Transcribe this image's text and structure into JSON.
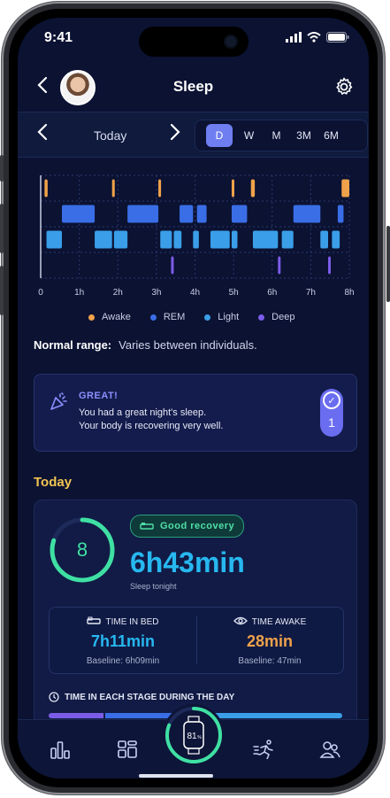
{
  "status": {
    "time": "9:41"
  },
  "header": {
    "title": "Sleep"
  },
  "date_nav": {
    "label": "Today",
    "periods": [
      "D",
      "W",
      "M",
      "3M",
      "6M"
    ],
    "selected": "D"
  },
  "chart_data": {
    "type": "timeline",
    "x_ticks": [
      "0",
      "1h",
      "2h",
      "3h",
      "4h",
      "5h",
      "6h",
      "7h",
      "8h"
    ],
    "xlim": [
      0,
      8
    ],
    "rows": [
      "Awake",
      "REM",
      "Light",
      "Deep"
    ],
    "legend": [
      {
        "label": "Awake",
        "color": "#f0a24a"
      },
      {
        "label": "REM",
        "color": "#3a6ee6"
      },
      {
        "label": "Light",
        "color": "#3a9ee8"
      },
      {
        "label": "Deep",
        "color": "#7b5ce8"
      }
    ],
    "segments": [
      {
        "stage": "Awake",
        "start": 0.1,
        "end": 0.18
      },
      {
        "stage": "Awake",
        "start": 1.85,
        "end": 1.92
      },
      {
        "stage": "Awake",
        "start": 3.05,
        "end": 3.12
      },
      {
        "stage": "Awake",
        "start": 4.95,
        "end": 5.02
      },
      {
        "stage": "Awake",
        "start": 5.45,
        "end": 5.55
      },
      {
        "stage": "Awake",
        "start": 7.8,
        "end": 8.0
      },
      {
        "stage": "REM",
        "start": 0.55,
        "end": 1.4
      },
      {
        "stage": "REM",
        "start": 2.25,
        "end": 3.05
      },
      {
        "stage": "REM",
        "start": 3.6,
        "end": 3.95
      },
      {
        "stage": "REM",
        "start": 4.05,
        "end": 4.3
      },
      {
        "stage": "REM",
        "start": 4.95,
        "end": 5.35
      },
      {
        "stage": "REM",
        "start": 6.55,
        "end": 7.25
      },
      {
        "stage": "REM",
        "start": 7.7,
        "end": 7.85
      },
      {
        "stage": "Light",
        "start": 0.15,
        "end": 0.55
      },
      {
        "stage": "Light",
        "start": 1.4,
        "end": 1.85
      },
      {
        "stage": "Light",
        "start": 1.9,
        "end": 2.25
      },
      {
        "stage": "Light",
        "start": 3.1,
        "end": 3.4
      },
      {
        "stage": "Light",
        "start": 3.45,
        "end": 3.65
      },
      {
        "stage": "Light",
        "start": 3.95,
        "end": 4.1
      },
      {
        "stage": "Light",
        "start": 4.4,
        "end": 4.9
      },
      {
        "stage": "Light",
        "start": 4.95,
        "end": 5.1
      },
      {
        "stage": "Light",
        "start": 5.5,
        "end": 6.15
      },
      {
        "stage": "Light",
        "start": 6.25,
        "end": 6.55
      },
      {
        "stage": "Light",
        "start": 7.25,
        "end": 7.45
      },
      {
        "stage": "Light",
        "start": 7.55,
        "end": 7.75
      },
      {
        "stage": "Deep",
        "start": 3.38,
        "end": 3.43
      },
      {
        "stage": "Deep",
        "start": 6.15,
        "end": 6.2
      },
      {
        "stage": "Deep",
        "start": 7.45,
        "end": 7.5
      }
    ]
  },
  "normal_range": {
    "label": "Normal range:",
    "value": "Varies between individuals."
  },
  "great_card": {
    "heading": "GREAT!",
    "line1": "You had a great night's sleep.",
    "line2": "Your body is recovering very well.",
    "badge_count": "1"
  },
  "today": {
    "section_label": "Today",
    "score": "8",
    "score_fraction": 0.8,
    "recovery_badge": "Good recovery",
    "duration": "6h43min",
    "duration_caption": "Sleep tonight",
    "time_in_bed": {
      "label": "TIME IN BED",
      "value": "7h11min",
      "baseline": "Baseline: 6h09min",
      "color": "#27b8f0"
    },
    "time_awake": {
      "label": "TIME AWAKE",
      "value": "28min",
      "baseline": "Baseline: 47min",
      "color": "#f0a24a"
    },
    "stage_label": "TIME IN EACH STAGE DURING THE DAY"
  },
  "nav": {
    "center_value": "81",
    "center_unit": "%",
    "center_fraction": 0.81
  }
}
